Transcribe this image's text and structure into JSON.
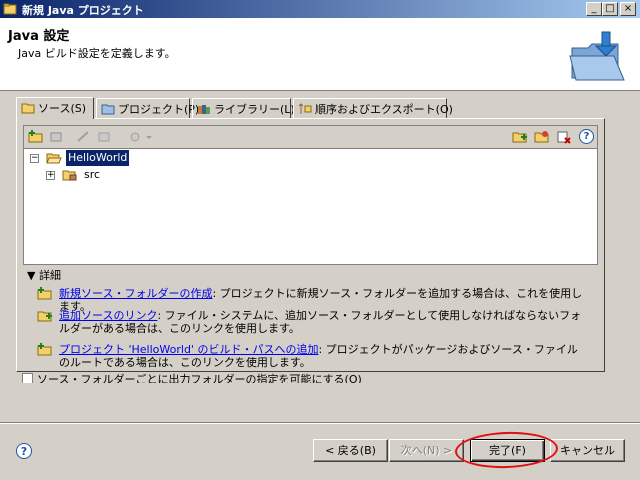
{
  "window": {
    "title": "新規 Java プロジェクト",
    "minimize_label": "_",
    "maximize_label": "□",
    "close_label": "×"
  },
  "header": {
    "title": "Java 設定",
    "description": "Java ビルド設定を定義します。"
  },
  "tabs": [
    {
      "label": "ソース(S)",
      "active": true
    },
    {
      "label": "プロジェクト(P)"
    },
    {
      "label": "ライブラリー(L)"
    },
    {
      "label": "順序およびエクスポート(O)"
    }
  ],
  "tree": {
    "root": "HelloWorld",
    "child": "src"
  },
  "toolbar": {
    "help_label": "?"
  },
  "details": {
    "label": "詳細",
    "items": [
      {
        "link": "新規ソース・フォルダーの作成",
        "text": ": プロジェクトに新規ソース・フォルダーを追加する場合は、これを使用します。"
      },
      {
        "link": "追加ソースのリンク",
        "text": ": ファイル・システムに、追加ソース・フォルダーとして使用しなければならないフォルダーがある場合は、このリンクを使用します。"
      },
      {
        "link": "プロジェクト 'HelloWorld' のビルド・パスへの追加",
        "text": ": プロジェクトがパッケージおよびソース・ファイルのルートである場合は、このリンクを使用します。"
      }
    ]
  },
  "checkbox": {
    "label": "ソース・フォルダーごとに出力フォルダーの指定を可能にする(O)"
  },
  "buttons": {
    "help": "?",
    "back": "< 戻る(B)",
    "next": "次へ(N) >",
    "finish": "完了(F)",
    "cancel": "キャンセル"
  },
  "colors": {
    "title_gradient_start": "#0a246a",
    "annotation_ellipse": "#e01010"
  }
}
